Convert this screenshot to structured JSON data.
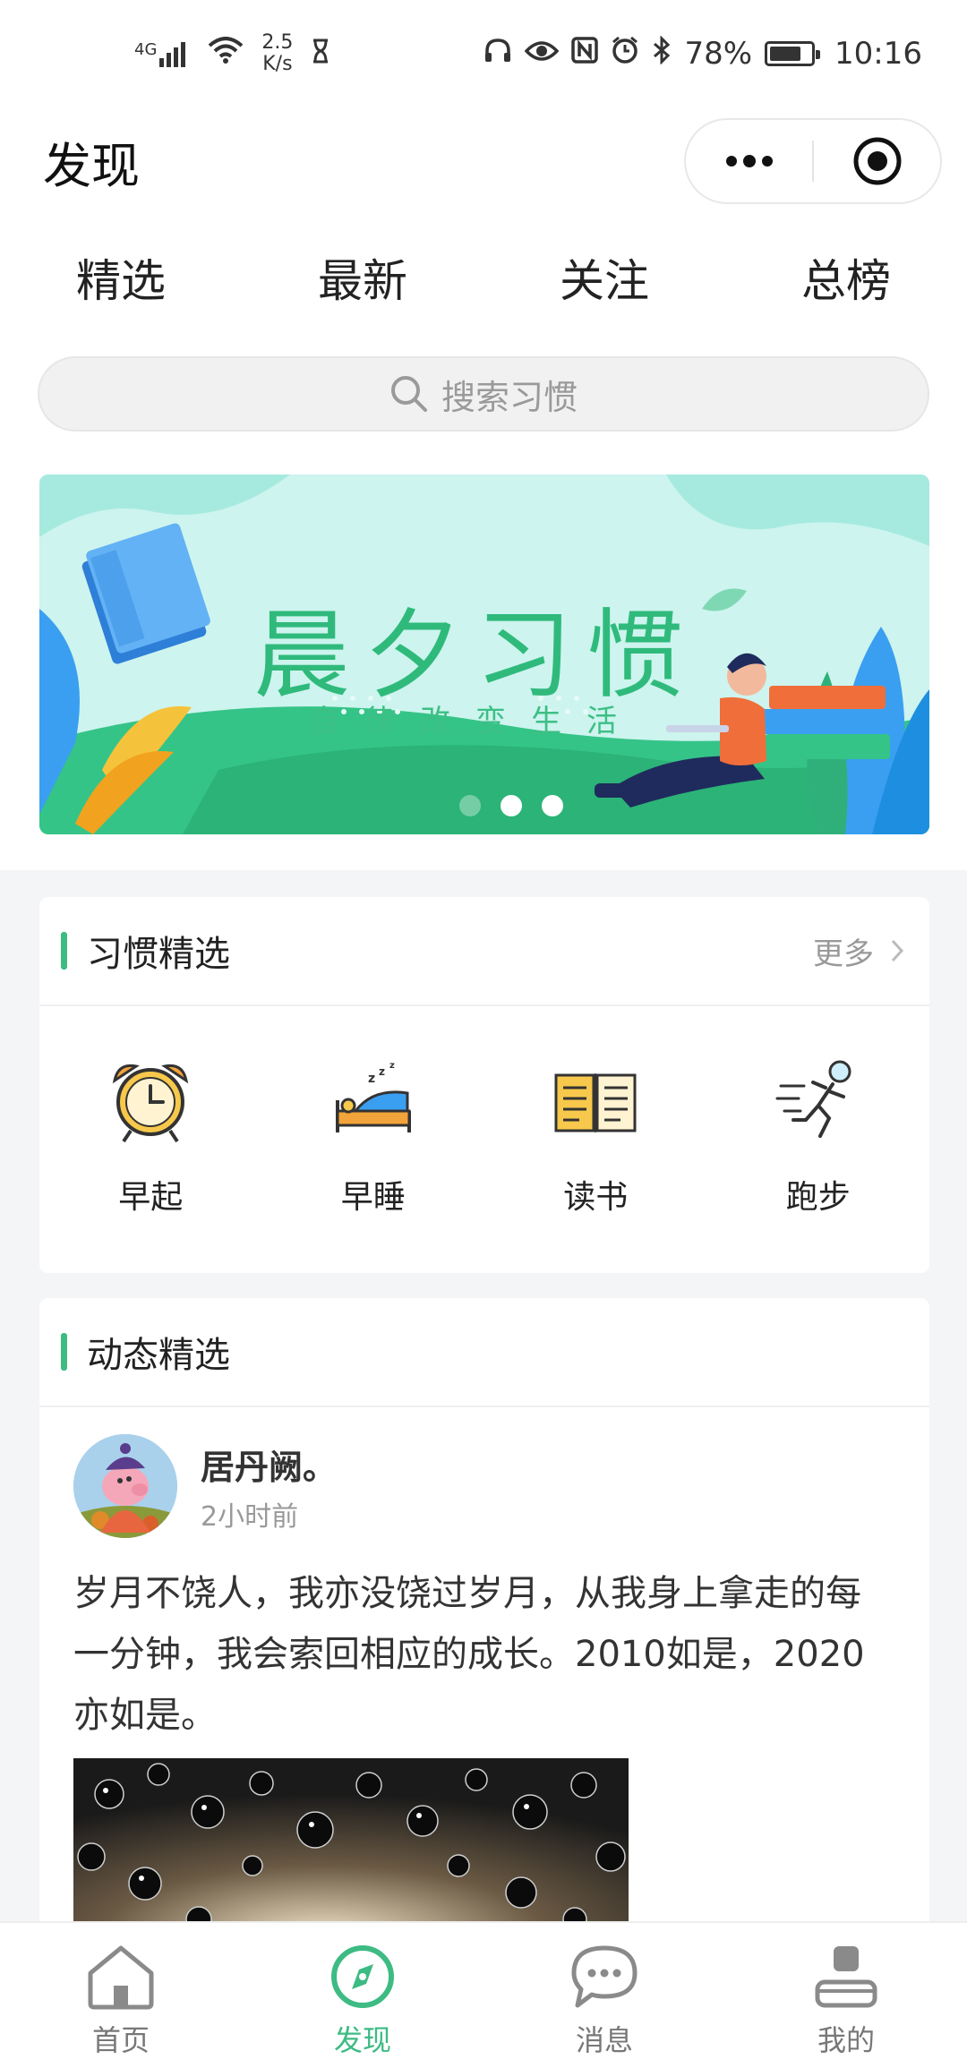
{
  "status_bar": {
    "network": "4G",
    "speed_value": "2.5",
    "speed_unit": "K/s",
    "battery": "78%",
    "battery_level": 0.78,
    "time": "10:16"
  },
  "header": {
    "title": "发现"
  },
  "tabs": [
    {
      "label": "精选",
      "active": true
    },
    {
      "label": "最新",
      "active": false
    },
    {
      "label": "关注",
      "active": false
    },
    {
      "label": "总榜",
      "active": false
    }
  ],
  "search": {
    "placeholder": "搜索习惯"
  },
  "banner": {
    "title": "晨夕习惯",
    "subtitle": "自律改变生活",
    "slide_count": 3,
    "active_slide": 2
  },
  "habit_section": {
    "title": "习惯精选",
    "more_label": "更多",
    "items": [
      {
        "label": "早起",
        "icon": "alarm-clock-icon"
      },
      {
        "label": "早睡",
        "icon": "bed-sleep-icon"
      },
      {
        "label": "读书",
        "icon": "open-book-icon"
      },
      {
        "label": "跑步",
        "icon": "running-person-icon"
      }
    ]
  },
  "feed_section": {
    "title": "动态精选",
    "post": {
      "user_name": "居丹阙。",
      "time": "2小时前",
      "text": "岁月不饶人，我亦没饶过岁月，从我身上拿走的每一分钟，我会索回相应的成长。2010如是，2020亦如是。"
    }
  },
  "bottom_nav": [
    {
      "label": "首页",
      "icon": "home-icon",
      "active": false
    },
    {
      "label": "发现",
      "icon": "compass-icon",
      "active": true
    },
    {
      "label": "消息",
      "icon": "chat-bubble-icon",
      "active": false
    },
    {
      "label": "我的",
      "icon": "profile-icon",
      "active": false
    }
  ],
  "colors": {
    "accent": "#3dbb83",
    "banner_bg": "#c9f3ec",
    "text": "#222222",
    "muted": "#999999"
  }
}
